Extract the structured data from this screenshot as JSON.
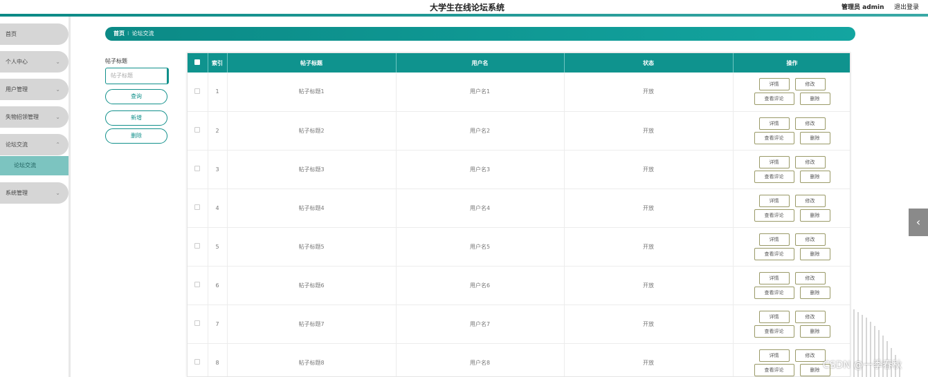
{
  "header": {
    "title": "大学生在线论坛系统",
    "admin": "管理员 admin",
    "logout": "退出登录"
  },
  "sidebar": {
    "items": [
      {
        "label": "首页"
      },
      {
        "label": "个人中心",
        "chevron": "⌄"
      },
      {
        "label": "用户管理",
        "chevron": "⌄"
      },
      {
        "label": "失物招领管理",
        "chevron": "⌄"
      },
      {
        "label": "论坛交流",
        "chevron": "⌃"
      },
      {
        "label": "系统管理",
        "chevron": "⌄"
      }
    ],
    "sub_item": "论坛交流"
  },
  "breadcrumb": {
    "home": "首页",
    "sep": "⁝",
    "current": "论坛交流"
  },
  "search": {
    "label": "帖子标题",
    "placeholder": "帖子标题",
    "query_btn": "查询",
    "add_btn": "新增",
    "delete_btn": "删除"
  },
  "table": {
    "headers": {
      "index": "索引",
      "title": "帖子标题",
      "username": "用户名",
      "status": "状态",
      "actions": "操作"
    },
    "rows": [
      {
        "index": "1",
        "title": "帖子标题1",
        "username": "用户名1",
        "status": "开放"
      },
      {
        "index": "2",
        "title": "帖子标题2",
        "username": "用户名2",
        "status": "开放"
      },
      {
        "index": "3",
        "title": "帖子标题3",
        "username": "用户名3",
        "status": "开放"
      },
      {
        "index": "4",
        "title": "帖子标题4",
        "username": "用户名4",
        "status": "开放"
      },
      {
        "index": "5",
        "title": "帖子标题5",
        "username": "用户名5",
        "status": "开放"
      },
      {
        "index": "6",
        "title": "帖子标题6",
        "username": "用户名6",
        "status": "开放"
      },
      {
        "index": "7",
        "title": "帖子标题7",
        "username": "用户名7",
        "status": "开放"
      },
      {
        "index": "8",
        "title": "帖子标题8",
        "username": "用户名8",
        "status": "开放"
      }
    ],
    "ops": {
      "detail": "详情",
      "edit": "修改",
      "comments": "查看评论",
      "delete": "删除"
    }
  },
  "side_arrow": "‹",
  "watermark": "CSDN @一季春秋",
  "colors": {
    "primary": "#0f938e",
    "submenu": "#7cc4c0",
    "sidebar_item": "#d6d6d6"
  }
}
